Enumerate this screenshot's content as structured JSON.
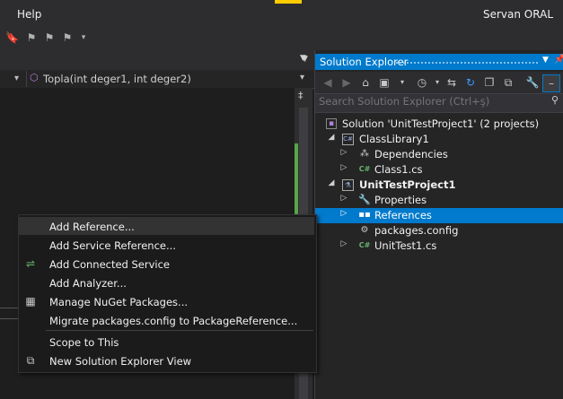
{
  "menubar": {
    "help": "Help",
    "user": "Servan ORAL"
  },
  "editor": {
    "method_nav": "Topla(int deger1, int deger2)"
  },
  "solution_explorer": {
    "title": "Solution Explorer",
    "search_placeholder": "Search Solution Explorer (Ctrl+ş)",
    "tree": [
      {
        "label": "Solution 'UnitTestProject1' (2 projects)",
        "icon": "solution-icon",
        "bold": false
      },
      {
        "label": "ClassLibrary1",
        "icon": "csharp-project-icon",
        "bold": false
      },
      {
        "label": "Dependencies",
        "icon": "dependencies-icon",
        "bold": false
      },
      {
        "label": "Class1.cs",
        "icon": "csharp-file-icon",
        "bold": false
      },
      {
        "label": "UnitTestProject1",
        "icon": "test-project-icon",
        "bold": true
      },
      {
        "label": "Properties",
        "icon": "wrench-icon",
        "bold": false
      },
      {
        "label": "References",
        "icon": "references-icon",
        "bold": false,
        "selected": true
      },
      {
        "label": "packages.config",
        "icon": "config-file-icon",
        "bold": false
      },
      {
        "label": "UnitTest1.cs",
        "icon": "csharp-file-icon",
        "bold": false
      }
    ]
  },
  "context_menu": {
    "items": [
      {
        "label": "Add Reference...",
        "icon": "",
        "highlighted": true
      },
      {
        "label": "Add Service Reference...",
        "icon": ""
      },
      {
        "label": "Add Connected Service",
        "icon": "connected-service-icon"
      },
      {
        "label": "Add Analyzer...",
        "icon": ""
      },
      {
        "label": "Manage NuGet Packages...",
        "icon": "nuget-icon"
      },
      {
        "label": "Migrate packages.config to PackageReference...",
        "icon": ""
      },
      {
        "label": "Scope to This",
        "icon": ""
      },
      {
        "label": "New Solution Explorer View",
        "icon": "new-view-icon"
      }
    ]
  },
  "colors": {
    "accent": "#007acc",
    "selection": "#007acc",
    "background": "#1e1e1e"
  }
}
